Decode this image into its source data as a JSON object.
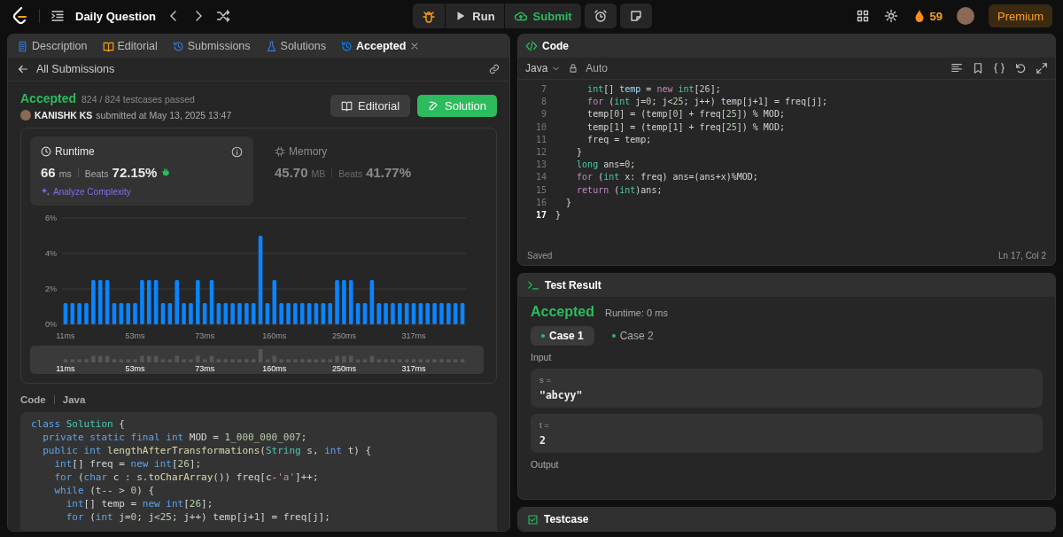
{
  "top_bar": {
    "title": "Daily Question",
    "run": "Run",
    "submit": "Submit",
    "streak": "59",
    "premium": "Premium"
  },
  "left_panel": {
    "tabs": [
      {
        "label": "Description",
        "kind": "doc",
        "selected": false
      },
      {
        "label": "Editorial",
        "kind": "book",
        "selected": false
      },
      {
        "label": "Submissions",
        "kind": "history",
        "selected": false
      },
      {
        "label": "Solutions",
        "kind": "flask",
        "selected": false
      },
      {
        "label": "Accepted",
        "kind": "history",
        "selected": true
      }
    ],
    "back_link": "All Submissions",
    "status": "Accepted",
    "testcases": "824 / 824 testcases passed",
    "author": "KANISHK KS",
    "submitted": "submitted at May 13, 2025 13:47",
    "buttons": [
      {
        "label": "Editorial",
        "kind": "secondary"
      },
      {
        "label": "Solution",
        "kind": "primary"
      }
    ],
    "metrics": [
      {
        "label": "Runtime",
        "value": "66",
        "unit": "ms",
        "beats_label": "Beats",
        "beats": "72.15%",
        "selected": true,
        "link": "Analyze Complexity"
      },
      {
        "label": "Memory",
        "value": "45.70",
        "unit": "MB",
        "beats_label": "Beats",
        "beats": "41.77%",
        "selected": false
      }
    ],
    "chart_data": {
      "type": "bar",
      "ylim": [
        0,
        6
      ],
      "yticks": [
        {
          "value": 0,
          "label": "0%"
        },
        {
          "value": 2,
          "label": "2%"
        },
        {
          "value": 4,
          "label": "4%"
        },
        {
          "value": 6,
          "label": "6%"
        }
      ],
      "categories": [
        "11ms",
        null,
        null,
        null,
        null,
        null,
        null,
        null,
        null,
        null,
        "53ms",
        null,
        null,
        null,
        null,
        null,
        null,
        null,
        null,
        null,
        "73ms",
        null,
        null,
        null,
        null,
        null,
        null,
        null,
        null,
        null,
        "160ms",
        null,
        null,
        null,
        null,
        null,
        null,
        null,
        null,
        null,
        "250ms",
        null,
        null,
        null,
        null,
        null,
        null,
        null,
        null,
        null,
        "317ms",
        null,
        null,
        null,
        null,
        null,
        null,
        null
      ],
      "values": [
        1.2,
        1.2,
        1.2,
        1.2,
        2.5,
        2.5,
        2.5,
        1.2,
        1.2,
        1.2,
        1.2,
        2.5,
        2.5,
        2.5,
        1.2,
        1.2,
        2.5,
        1.2,
        1.2,
        2.5,
        1.2,
        2.5,
        1.2,
        1.2,
        1.2,
        1.2,
        1.2,
        1.2,
        5.0,
        1.2,
        2.5,
        1.2,
        1.2,
        1.2,
        1.2,
        1.2,
        1.2,
        1.2,
        1.2,
        2.5,
        2.5,
        2.5,
        1.2,
        1.2,
        2.5,
        1.2,
        1.2,
        1.2,
        1.2,
        1.2,
        1.2,
        1.2,
        1.2,
        1.2,
        1.2,
        1.2,
        1.2,
        1.2
      ]
    },
    "overview_labels": [
      "11ms",
      "53ms",
      "73ms",
      "160ms",
      "250ms",
      "317ms"
    ],
    "code_label": "Code",
    "code_language": "Java",
    "code": [
      [
        {
          "text": "class ",
          "kind": "keyword"
        },
        {
          "text": "Solution",
          "kind": "type"
        },
        {
          "text": " {",
          "kind": "plain"
        }
      ],
      [
        {
          "text": "  private static final int ",
          "kind": "keyword"
        },
        {
          "text": "MOD = ",
          "kind": "plain"
        },
        {
          "text": "1_000_000_007",
          "kind": "number"
        },
        {
          "text": ";",
          "kind": "plain"
        }
      ],
      [
        {
          "text": "  public int ",
          "kind": "keyword"
        },
        {
          "text": "lengthAfterTransformations",
          "kind": "function"
        },
        {
          "text": "(",
          "kind": "plain"
        },
        {
          "text": "String",
          "kind": "type"
        },
        {
          "text": " s, ",
          "kind": "plain"
        },
        {
          "text": "int",
          "kind": "keyword"
        },
        {
          "text": " t) {",
          "kind": "plain"
        }
      ],
      [
        {
          "text": "    int",
          "kind": "keyword"
        },
        {
          "text": "[] freq = ",
          "kind": "plain"
        },
        {
          "text": "new int",
          "kind": "keyword"
        },
        {
          "text": "[",
          "kind": "plain"
        },
        {
          "text": "26",
          "kind": "number"
        },
        {
          "text": "];",
          "kind": "plain"
        }
      ],
      [
        {
          "text": "    for ",
          "kind": "keyword"
        },
        {
          "text": "(",
          "kind": "plain"
        },
        {
          "text": "char",
          "kind": "keyword"
        },
        {
          "text": " c : s.",
          "kind": "plain"
        },
        {
          "text": "toCharArray",
          "kind": "function"
        },
        {
          "text": "()) freq[c-",
          "kind": "plain"
        },
        {
          "text": "'a'",
          "kind": "string"
        },
        {
          "text": "]++;",
          "kind": "plain"
        }
      ],
      [
        {
          "text": "    while ",
          "kind": "keyword"
        },
        {
          "text": "(t-- > ",
          "kind": "plain"
        },
        {
          "text": "0",
          "kind": "number"
        },
        {
          "text": ") {",
          "kind": "plain"
        }
      ],
      [
        {
          "text": "      int",
          "kind": "keyword"
        },
        {
          "text": "[] temp = ",
          "kind": "plain"
        },
        {
          "text": "new int",
          "kind": "keyword"
        },
        {
          "text": "[",
          "kind": "plain"
        },
        {
          "text": "26",
          "kind": "number"
        },
        {
          "text": "];",
          "kind": "plain"
        }
      ],
      [
        {
          "text": "      for ",
          "kind": "keyword"
        },
        {
          "text": "(",
          "kind": "plain"
        },
        {
          "text": "int",
          "kind": "keyword"
        },
        {
          "text": " j=",
          "kind": "plain"
        },
        {
          "text": "0",
          "kind": "number"
        },
        {
          "text": "; j<",
          "kind": "plain"
        },
        {
          "text": "25",
          "kind": "number"
        },
        {
          "text": "; j++) temp[j+",
          "kind": "plain"
        },
        {
          "text": "1",
          "kind": "number"
        },
        {
          "text": "] = freq[j];",
          "kind": "plain"
        }
      ]
    ]
  },
  "editor": {
    "title": "Code",
    "language": "Java",
    "mode": "Auto",
    "status": "Saved",
    "cursor": "Ln 17, Col 2",
    "lines": [
      {
        "number": "7",
        "current": false,
        "tokens": [
          {
            "text": "      int",
            "kind": "type"
          },
          {
            "text": "[] ",
            "kind": "plain"
          },
          {
            "text": "temp",
            "kind": "variable"
          },
          {
            "text": " = ",
            "kind": "plain"
          },
          {
            "text": "new",
            "kind": "control"
          },
          {
            "text": " int",
            "kind": "type"
          },
          {
            "text": "[",
            "kind": "plain"
          },
          {
            "text": "26",
            "kind": "number"
          },
          {
            "text": "];",
            "kind": "plain"
          }
        ]
      },
      {
        "number": "8",
        "current": false,
        "tokens": [
          {
            "text": "      for",
            "kind": "control"
          },
          {
            "text": " (",
            "kind": "plain"
          },
          {
            "text": "int",
            "kind": "type"
          },
          {
            "text": " j=",
            "kind": "plain"
          },
          {
            "text": "0",
            "kind": "number"
          },
          {
            "text": "; j<",
            "kind": "plain"
          },
          {
            "text": "25",
            "kind": "number"
          },
          {
            "text": "; j++) temp[j+",
            "kind": "plain"
          },
          {
            "text": "1",
            "kind": "number"
          },
          {
            "text": "] = freq[j];",
            "kind": "plain"
          }
        ]
      },
      {
        "number": "9",
        "current": false,
        "tokens": [
          {
            "text": "      temp[",
            "kind": "plain"
          },
          {
            "text": "0",
            "kind": "number"
          },
          {
            "text": "] = (temp[",
            "kind": "plain"
          },
          {
            "text": "0",
            "kind": "number"
          },
          {
            "text": "] + freq[",
            "kind": "plain"
          },
          {
            "text": "25",
            "kind": "number"
          },
          {
            "text": "]) % MOD;",
            "kind": "plain"
          }
        ]
      },
      {
        "number": "10",
        "current": false,
        "tokens": [
          {
            "text": "      temp[",
            "kind": "plain"
          },
          {
            "text": "1",
            "kind": "number"
          },
          {
            "text": "] = (temp[",
            "kind": "plain"
          },
          {
            "text": "1",
            "kind": "number"
          },
          {
            "text": "] + freq[",
            "kind": "plain"
          },
          {
            "text": "25",
            "kind": "number"
          },
          {
            "text": "]) % MOD;",
            "kind": "plain"
          }
        ]
      },
      {
        "number": "11",
        "current": false,
        "tokens": [
          {
            "text": "      freq = temp;",
            "kind": "plain"
          }
        ]
      },
      {
        "number": "12",
        "current": false,
        "tokens": [
          {
            "text": "    }",
            "kind": "plain"
          }
        ]
      },
      {
        "number": "13",
        "current": false,
        "tokens": [
          {
            "text": "    long",
            "kind": "type"
          },
          {
            "text": " ans=",
            "kind": "plain"
          },
          {
            "text": "0",
            "kind": "number"
          },
          {
            "text": ";",
            "kind": "plain"
          }
        ]
      },
      {
        "number": "14",
        "current": false,
        "tokens": [
          {
            "text": "    for",
            "kind": "control"
          },
          {
            "text": " (",
            "kind": "plain"
          },
          {
            "text": "int",
            "kind": "type"
          },
          {
            "text": " x: freq) ans=(ans+x)%MOD;",
            "kind": "plain"
          }
        ]
      },
      {
        "number": "15",
        "current": false,
        "tokens": [
          {
            "text": "    return",
            "kind": "control"
          },
          {
            "text": " (",
            "kind": "plain"
          },
          {
            "text": "int",
            "kind": "type"
          },
          {
            "text": ")ans;",
            "kind": "plain"
          }
        ]
      },
      {
        "number": "16",
        "current": false,
        "tokens": [
          {
            "text": "  }",
            "kind": "plain"
          }
        ]
      },
      {
        "number": "17",
        "current": true,
        "tokens": [
          {
            "text": "}",
            "kind": "plain"
          }
        ]
      }
    ]
  },
  "test_result": {
    "title": "Test Result",
    "status": "Accepted",
    "runtime": "Runtime: 0 ms",
    "cases": [
      {
        "label": "Case 1",
        "selected": true
      },
      {
        "label": "Case 2",
        "selected": false
      }
    ],
    "input_label": "Input",
    "inputs": [
      {
        "name": "s =",
        "value": "\"abcyy\""
      },
      {
        "name": "t =",
        "value": "2"
      }
    ],
    "output_label": "Output"
  },
  "testcase_panel": {
    "title": "Testcase"
  }
}
